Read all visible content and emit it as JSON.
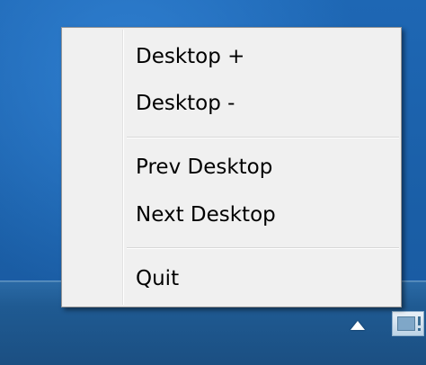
{
  "menu": {
    "items": [
      {
        "label": "Desktop +"
      },
      {
        "label": "Desktop -"
      },
      {
        "label": "Prev Desktop"
      },
      {
        "label": "Next Desktop"
      },
      {
        "label": "Quit"
      }
    ]
  },
  "tray": {
    "expand_icon": "chevron-up-icon",
    "app_icon": "virtual-desktop-app-icon"
  },
  "colors": {
    "desktop": "#1d5fa3",
    "taskbar": "#1f5a92",
    "menu_background": "#f0f0f0",
    "menu_border": "#979797",
    "menu_text": "#000000"
  }
}
